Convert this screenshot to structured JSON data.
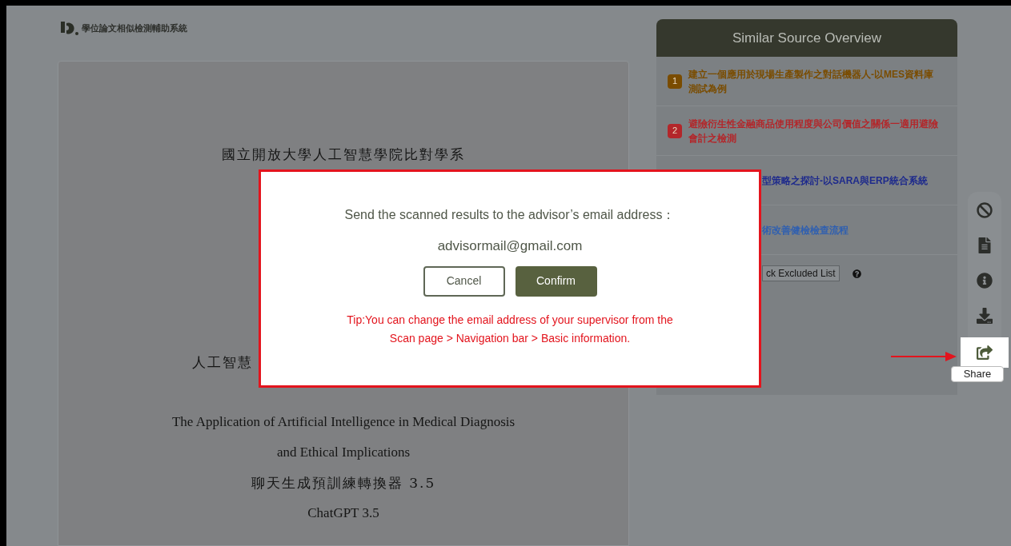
{
  "header": {
    "logo_title": "學位論文相似檢測輔助系統"
  },
  "document": {
    "lines": [
      {
        "kind": "zh",
        "text": "國立開放大學人工智慧學院比對學系"
      },
      {
        "kind": "zh_partial",
        "text": "人工智慧"
      },
      {
        "kind": "en",
        "text": "The Application of Artificial Intelligence in Medical Diagnosis"
      },
      {
        "kind": "en",
        "text": "and Ethical Implications"
      },
      {
        "kind": "zh",
        "text": "聊天生成預訓練轉換器 3.5"
      },
      {
        "kind": "en",
        "text": "ChatGPT 3.5"
      }
    ]
  },
  "sidebar": {
    "title": "Similar Source Overview",
    "sources": [
      {
        "number": "1",
        "text": "建立一個應用於現場生產製作之對話機器人-以MES資料庫測試為例",
        "color": "#7a4c00"
      },
      {
        "number": "2",
        "text": "避險衍生性金融商品使用程度與公司價值之關係一適用避險會計之檢測",
        "color": "#b3262a"
      },
      {
        "text": "型策略之探討-以SARA與ERP統合系統",
        "color": "#1e2a8c"
      },
      {
        "text": "術改善健檢檢查流程",
        "color": "#2f5fb0"
      }
    ],
    "excluded_button": "ck Excluded List"
  },
  "toolbar": {
    "items": [
      {
        "kind": "ban",
        "selected": false
      },
      {
        "kind": "file",
        "selected": false
      },
      {
        "kind": "info",
        "selected": false
      },
      {
        "kind": "download",
        "selected": false
      },
      {
        "kind": "share",
        "selected": true
      }
    ],
    "tooltip": "Share"
  },
  "dialog": {
    "message": "Send the scanned results to the advisor’s email address：",
    "email": "advisormail@gmail.com",
    "cancel": "Cancel",
    "confirm": "Confirm",
    "tip_lines": [
      "Tip:You can change the email address of your supervisor from the",
      "Scan page > Navigation bar > Basic information."
    ]
  }
}
